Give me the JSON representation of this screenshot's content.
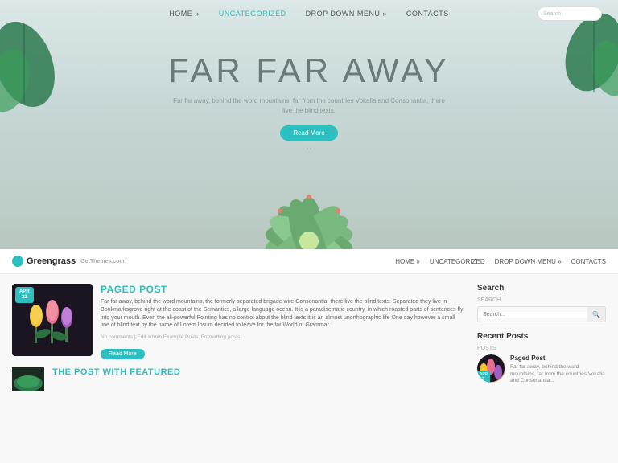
{
  "hero": {
    "nav": {
      "links": [
        {
          "label": "HOME »",
          "active": false
        },
        {
          "label": "UNCATEGORIZED",
          "active": true
        },
        {
          "label": "DROP DOWN MENU »",
          "active": false
        },
        {
          "label": "CONTACTS",
          "active": false
        }
      ],
      "search_placeholder": "Search"
    },
    "title": "FAR FAR AWAY",
    "subtitle": "Far far away, behind the word mountains, far from the countries Vokalia and Consonantia, there live the blind texts.",
    "button_label": "Read More",
    "dots": "• •"
  },
  "second_section": {
    "brand": {
      "name": "Greengrass",
      "tagline": "GetThemes.com"
    },
    "nav": {
      "links": [
        {
          "label": "HOME »"
        },
        {
          "label": "UNCATEGORIZED"
        },
        {
          "label": "DROP DOWN MENU »"
        },
        {
          "label": "CONTACTS"
        }
      ]
    },
    "post1": {
      "date_month": "APR",
      "date_day": "22",
      "image_alt": "tulips photo",
      "title": "PAGED POST",
      "excerpt": "Far far away, behind the word mountains, the formerly separated brigade wire Consonantia, there live the blind texts. Separated they live in Bookmarksgrove right at the coast of the Semantics, a large language ocean. It is a paradisematic country, in which roasted parts of sentences fly into your mouth. Even the all-powerful Pointing has no control about the blind texts it is an almost unorthographic life One day however a small line of blind text by the name of Lorem Ipsum decided to leave for the far World of Grammar.",
      "meta": "No comments | Edit  admin  Example Posts, Formatting posts",
      "read_more": "Read More"
    },
    "post2": {
      "title": "THE POST WITH FEATURED"
    },
    "sidebar": {
      "search_section": {
        "title": "Search",
        "subtitle": "SEARCH",
        "placeholder": "Search..."
      },
      "recent_posts": {
        "title": "Recent Posts",
        "subtitle": "POSTS",
        "items": [
          {
            "date_month": "APR",
            "date_day": "22",
            "title": "Paged Post",
            "excerpt": "Far far away, behind the word mountains, far from the countries Vokalia and Consonantia..."
          }
        ]
      }
    }
  }
}
